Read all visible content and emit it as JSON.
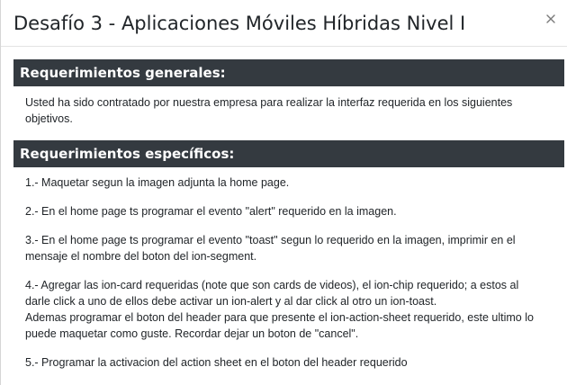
{
  "modal": {
    "title": "Desafío 3 - Aplicaciones Móviles Híbridas Nivel I",
    "close_icon": "close-icon"
  },
  "general": {
    "heading": "Requerimientos generales:",
    "text": "Usted ha sido contratado por nuestra empresa para realizar la interfaz requerida en los siguientes objetivos."
  },
  "specific": {
    "heading": "Requerimientos específicos:",
    "items": [
      {
        "text": "1.- Maquetar segun la imagen adjunta la home page."
      },
      {
        "text": "2.- En el home page ts programar el evento \"alert\" requerido en la imagen."
      },
      {
        "text": "3.- En el home page ts programar el evento \"toast\" segun lo requerido en la imagen, imprimir en el mensaje el nombre del boton del ion-segment."
      },
      {
        "text": "4.- Agregar las ion-card requeridas (note que son cards de videos), el ion-chip requerido; a estos al darle click a uno de ellos debe activar un ion-alert y al dar click al otro un ion-toast.",
        "text2": "Ademas programar el boton del header para que presente el ion-action-sheet requerido, este ultimo lo puede maquetar como guste. Recordar dejar un boton de \"cancel\"."
      },
      {
        "text": "5.- Programar la activacion del action sheet en el boton del header requerido"
      }
    ]
  }
}
